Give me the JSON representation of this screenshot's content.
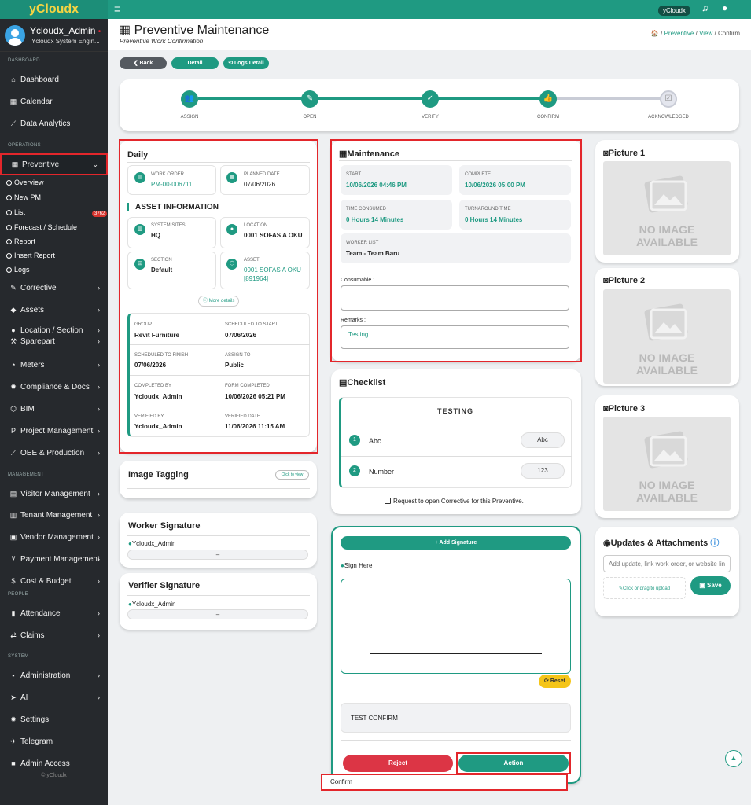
{
  "app": {
    "logo": "yCloudx",
    "org_badge": "yCloudx",
    "hamburger_icon": "hamburger-icon",
    "bell_icon": "bell-icon",
    "user_icon": "user-icon"
  },
  "profile": {
    "name": "Ycloudx_Admin",
    "role": "Ycloudx System Engin...",
    "status_dot": "•"
  },
  "sidebar": {
    "head_dashboard": "DASHBOARD",
    "dashboard": "Dashboard",
    "calendar": "Calendar",
    "data_analytics": "Data Analytics",
    "head_operations": "OPERATIONS",
    "preventive": "Preventive",
    "sub": {
      "overview": "Overview",
      "new_pm": "New PM",
      "list": "List",
      "list_count": "3762",
      "forecast": "Forecast / Schedule",
      "report": "Report",
      "insert_report": "Insert Report",
      "logs": "Logs"
    },
    "corrective": "Corrective",
    "assets": "Assets",
    "location": "Location / Section",
    "sparepart": "Sparepart",
    "meters": "Meters",
    "compliance": "Compliance & Docs",
    "bim": "BIM",
    "project": "Project Management",
    "oee": "OEE & Production",
    "head_management": "MANAGEMENT",
    "visitor": "Visitor Management",
    "tenant": "Tenant Management",
    "vendor": "Vendor Management",
    "payment": "Payment Management",
    "cost": "Cost & Budget",
    "head_people": "PEOPLE",
    "attendance": "Attendance",
    "claims": "Claims",
    "head_system": "SYSTEM",
    "administration": "Administration",
    "ai": "AI",
    "settings": "Settings",
    "telegram": "Telegram",
    "admin_access": "Admin Access",
    "footer": "© yCloudx"
  },
  "header": {
    "title": "Preventive Maintenance",
    "subtitle": "Preventive Work Confirmation",
    "crumb_home": "🏠",
    "crumb_preventive": "Preventive",
    "crumb_view": "View",
    "crumb_confirm": "Confirm",
    "sep": "/"
  },
  "buttons": {
    "back": "❮ Back",
    "detail": "Detail",
    "logs_detail": "⟲ Logs Detail"
  },
  "steps": [
    "ASSIGN",
    "OPEN",
    "VERIFY",
    "CONFIRM",
    "ACKNOWLEDGED"
  ],
  "daily": {
    "title": "Daily",
    "work_order_label": "WORK ORDER",
    "work_order": "PM-00-006711",
    "planned_date_label": "PLANNED DATE",
    "planned_date": "07/06/2026",
    "asset_info": "ASSET INFORMATION",
    "system_sites_label": "SYSTEM SITES",
    "system_sites": "HQ",
    "location_label": "LOCATION",
    "location": "0001 SOFAS A OKU",
    "section_label": "SECTION",
    "section": "Default",
    "asset_label": "ASSET",
    "asset_l1": "0001 SOFAS A OKU",
    "asset_l2": "[891964]",
    "more_details": "More details",
    "group_label": "GROUP",
    "group": "Revit Furniture",
    "sched_start_label": "SCHEDULED TO START",
    "sched_start": "07/06/2026",
    "sched_finish_label": "SCHEDULED TO FINISH",
    "sched_finish": "07/06/2026",
    "assign_to_label": "ASSIGN TO",
    "assign_to": "Public",
    "completed_by_label": "COMPLETED BY",
    "completed_by": "Ycloudx_Admin",
    "form_completed_label": "FORM COMPLETED",
    "form_completed": "10/06/2026 05:21 PM",
    "verified_by_label": "VERIFIED BY",
    "verified_by": "Ycloudx_Admin",
    "verified_date_label": "VERIFIED DATE",
    "verified_date": "11/06/2026 11:15 AM"
  },
  "image_tagging": {
    "title": "Image Tagging",
    "btn": "Click to view"
  },
  "worker_sig": {
    "title": "Worker Signature",
    "name": "Ycloudx_Admin",
    "dash": "–"
  },
  "verifier_sig": {
    "title": "Verifier Signature",
    "name": "Ycloudx_Admin",
    "dash": "–"
  },
  "maintenance": {
    "title": "Maintenance",
    "start_label": "START",
    "start": "10/06/2026 04:46 PM",
    "complete_label": "COMPLETE",
    "complete": "10/06/2026 05:00 PM",
    "time_consumed_label": "TIME CONSUMED",
    "time_consumed": "0 Hours 14 Minutes",
    "turnaround_label": "TURNAROUND TIME",
    "turnaround": "0 Hours 14 Minutes",
    "worker_list_label": "WORKER LIST",
    "worker_list": "Team - Team Baru",
    "consumable_label": "Consumable :",
    "consumable_value": "",
    "remarks_label": "Remarks :",
    "remarks_value": "Testing"
  },
  "checklist": {
    "title": "Checklist",
    "header": "TESTING",
    "items": [
      {
        "n": "1",
        "label": "Abc",
        "value": "Abc"
      },
      {
        "n": "2",
        "label": "Number",
        "value": "123"
      }
    ],
    "corrective_request": "Request to open Corrective for this Preventive."
  },
  "signature": {
    "add": "+ Add Signature",
    "sign_here": "Sign Here",
    "reset": "⟳ Reset",
    "confirm_text": "TEST CONFIRM",
    "reject": "Reject",
    "action": "Action",
    "dropdown_option": "Confirm"
  },
  "pictures": {
    "p1": "Picture 1",
    "p2": "Picture 2",
    "p3": "Picture 3",
    "no_image_1": "NO IMAGE",
    "no_image_2": "AVAILABLE"
  },
  "updates": {
    "title": "Updates & Attachments",
    "placeholder": "Add update, link work order, or website link",
    "upload": "Click or drag to upload",
    "save": "Save"
  },
  "colors": {
    "brand": "#1f9a82",
    "sidebar_bg": "#26292d",
    "danger": "#dc3545",
    "highlight": "#e3262b",
    "warning": "#f5c518"
  }
}
